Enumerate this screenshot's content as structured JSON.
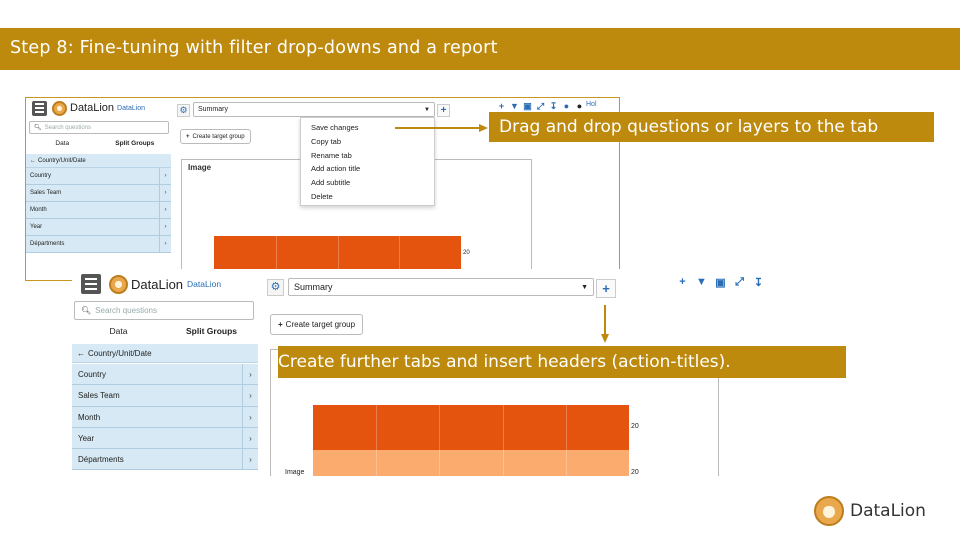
{
  "slide": {
    "title": "Step 8: Fine-tuning with filter drop-downs and a report",
    "colors": {
      "accent": "#bd8a0e",
      "nav_bg": "#d6e9f4",
      "bar_dark": "#e5540f",
      "bar_light": "#fbab6e",
      "link_blue": "#2a6db5"
    }
  },
  "app": {
    "brand_name": "DataLion",
    "brand_sub": "DataLion",
    "search_placeholder": "Search questions",
    "tab_data": "Data",
    "tab_split_groups": "Split Groups",
    "nav_back": "Country/Unit/Date",
    "nav_items": [
      "Country",
      "Sales Team",
      "Month",
      "Year",
      "Départments"
    ],
    "tab_select_value": "Summary",
    "add_tab_icon": "plus-icon",
    "target_group_button": "Create target group",
    "panel_title": "Image",
    "toolbar_icons": [
      "plus-icon",
      "filter-icon",
      "folder-icon",
      "expand-icon",
      "download-icon",
      "bell-icon",
      "user-icon"
    ],
    "user_label_truncated": "Hol"
  },
  "context_menu": {
    "items": [
      "Save changes",
      "Copy tab",
      "Rename tab",
      "Add action title",
      "Add subtitle",
      "Delete"
    ]
  },
  "chart_data": {
    "type": "bar",
    "orientation": "horizontal",
    "categories": [
      "",
      "Image"
    ],
    "series": [
      {
        "values": [
          20
        ]
      },
      {
        "values": [
          20
        ]
      }
    ],
    "data_labels": [
      "20",
      "20"
    ]
  },
  "callouts": {
    "drag_drop": "Drag and drop questions or layers to the tab",
    "create_tabs": "Create further tabs and insert headers (action-titles)."
  },
  "footer": {
    "brand": "DataLion"
  }
}
